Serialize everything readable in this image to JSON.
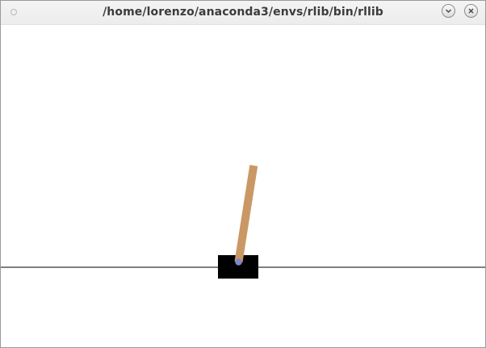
{
  "window": {
    "title": "/home/lorenzo/anaconda3/envs/rlib/bin/rllib"
  },
  "controls": {
    "minimize_icon": "chevron-down-icon",
    "close_icon": "close-icon"
  },
  "scene": {
    "colors": {
      "cart": "#000000",
      "pole": "#ca9865",
      "axle": "#8484cc",
      "track": "#000000",
      "background": "#ffffff"
    }
  }
}
